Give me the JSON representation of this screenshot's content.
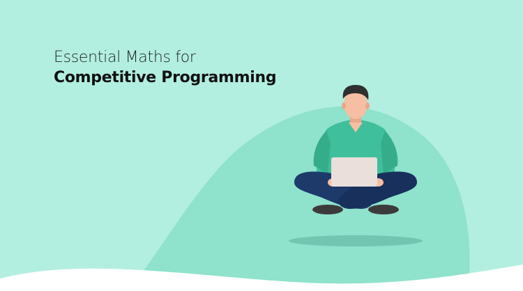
{
  "banner": {
    "title_line1": "Essential Maths for",
    "title_line2": "Competitive Programming"
  },
  "illustration": {
    "subject": "person-sitting-cross-legged-with-laptop-icon"
  },
  "colors": {
    "background": "#b2efe0",
    "blob": "#8fe2cc",
    "shirt": "#3fbf9b",
    "pants": "#1d3a6b",
    "skin": "#f6bfa3",
    "hair": "#2f2f2f",
    "laptop": "#eadfda",
    "shadow": "#6dbfab"
  }
}
